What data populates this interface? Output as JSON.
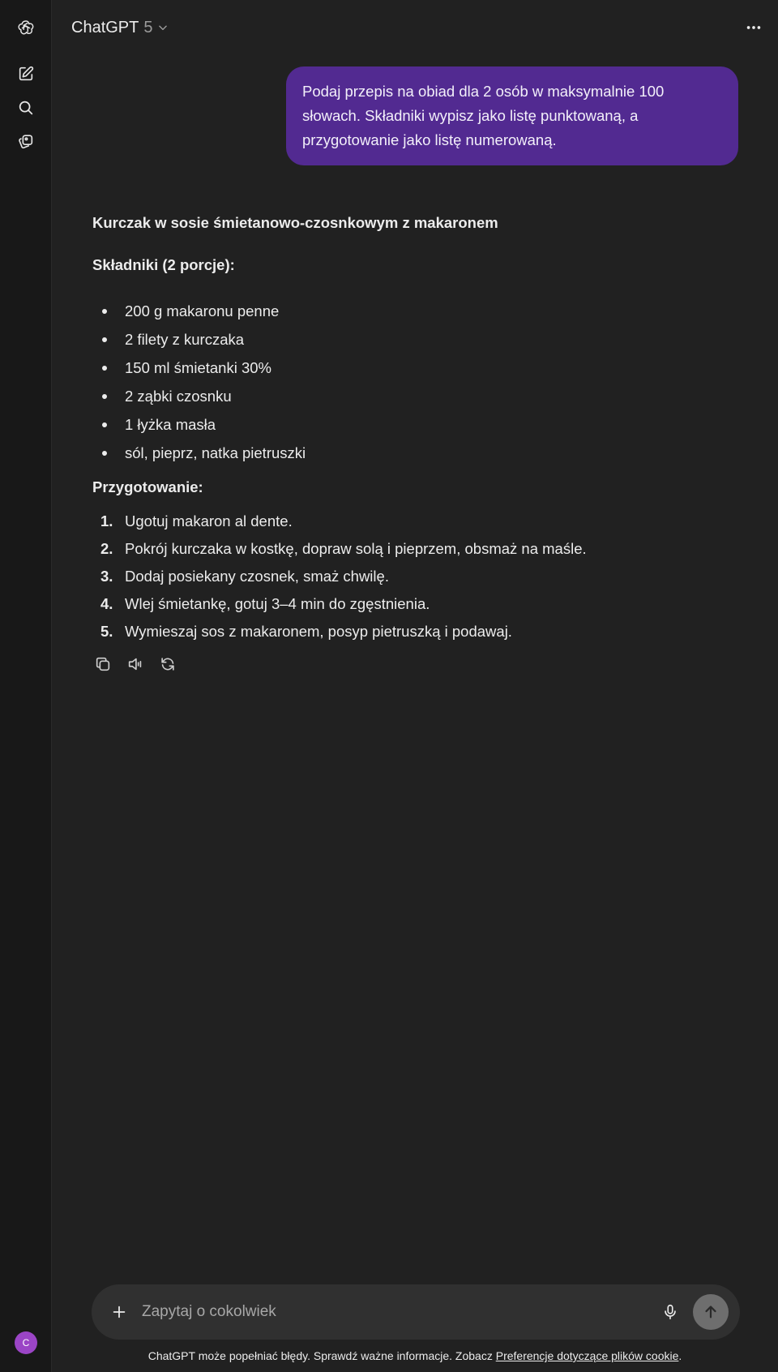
{
  "header": {
    "model_name": "ChatGPT",
    "model_version": "5"
  },
  "conversation": {
    "user_message": "Podaj przepis na obiad dla 2 osób w maksymalnie 100 słowach. Składniki wypisz jako listę punktowaną, a przygotowanie jako listę numerowaną.",
    "assistant": {
      "title": "Kurczak w sosie śmietanowo-czosnkowym z makaronem",
      "ingredients_heading": "Składniki (2 porcje):",
      "ingredients": [
        "200 g makaronu penne",
        "2 filety z kurczaka",
        "150 ml śmietanki 30%",
        "2 ząbki czosnku",
        "1 łyżka masła",
        "sól, pieprz, natka pietruszki"
      ],
      "steps_heading": "Przygotowanie:",
      "steps": [
        {
          "num": "1.",
          "text": "Ugotuj makaron al dente."
        },
        {
          "num": "2.",
          "text": "Pokrój kurczaka w kostkę, dopraw solą i pieprzem, obsmaż na maśle."
        },
        {
          "num": "3.",
          "text": "Dodaj posiekany czosnek, smaż chwilę."
        },
        {
          "num": "4.",
          "text": "Wlej śmietankę, gotuj 3–4 min do zgęstnienia."
        },
        {
          "num": "5.",
          "text": "Wymieszaj sos z makaronem, posyp pietruszką i podawaj."
        }
      ]
    }
  },
  "composer": {
    "placeholder": "Zapytaj o cokolwiek"
  },
  "footer": {
    "text": "ChatGPT może popełniać błędy. Sprawdź ważne informacje. Zobacz ",
    "link": "Preferencje dotyczące plików cookie",
    "suffix": "."
  },
  "user": {
    "avatar_initial": "C",
    "avatar_color": "#9b45c6"
  },
  "colors": {
    "background": "#212121",
    "sidebar": "#181818",
    "user_bubble": "#522a91",
    "composer": "#303030"
  }
}
